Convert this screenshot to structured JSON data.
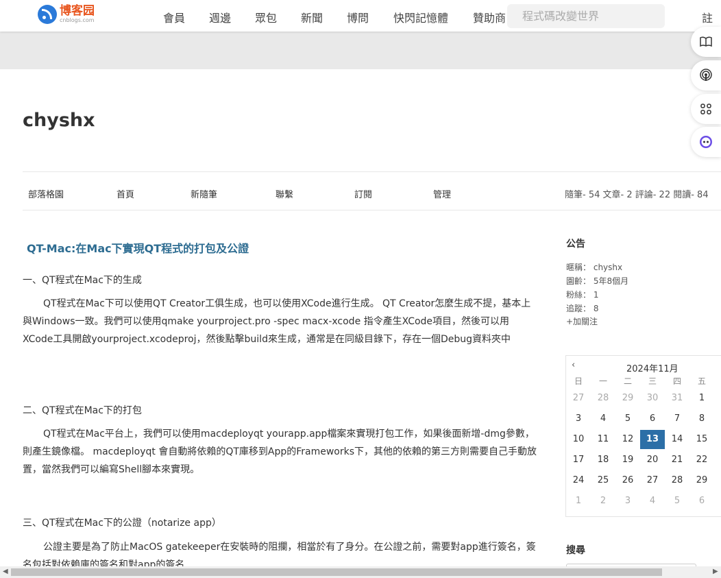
{
  "topbar": {
    "logo_name": "博客园",
    "logo_domain": "cnblogs.com",
    "nav": [
      "會員",
      "週邊",
      "眾包",
      "新聞",
      "博問",
      "快閃記憶體",
      "贊助商"
    ],
    "search_placeholder": "程式碼改變世界",
    "register": "註冊"
  },
  "side_tools": [
    "book-icon",
    "podcast-icon",
    "apps-icon",
    "assistant-icon"
  ],
  "blog": {
    "title": "chyshx",
    "nav": [
      "部落格園",
      "首頁",
      "新隨筆",
      "聯繫",
      "訂閱",
      "管理"
    ],
    "stats": "隨筆- 54  文章- 2  評論- 22  閱讀- 84"
  },
  "post": {
    "title": "QT-Mac:在Mac下實現QT程式的打包及公證",
    "sections": [
      {
        "heading": "一、QT程式在Mac下的生成",
        "text": "QT程式在Mac下可以使用QT Creator工俱生成，也可以使用XCode進行生成。 QT Creator怎麼生成不提，基本上與Windows一致。我們可以使用qmake yourproject.pro -spec macx-xcode 指令產生XCode項目，然後可以用XCode工具開啟yourproject.xcodeproj，然後點擊build來生成，通常是在同級目錄下，存在一個Debug資料夾中"
      },
      {
        "heading": "二、QT程式在Mac下的打包",
        "text": "QT程式在Mac平台上，我們可以使用macdeployqt yourapp.app檔案來實現打包工作，如果後面新增-dmg參數，則產生鏡像檔。 macdeployqt 會自動將依賴的QT庫移到App的Frameworks下，其他的依賴的第三方則需要自己手動放置，當然我們可以編寫Shell腳本來實現。"
      },
      {
        "heading": "三、QT程式在Mac下的公證（notarize app）",
        "text": "公證主要是為了防止MacOS gatekeeper在安裝時的阻攔，相當於有了身分。在公證之前，需要對app進行簽名，簽名包括對依賴庫的簽名和對app的簽名"
      }
    ]
  },
  "sidebar": {
    "notice_title": "公告",
    "profile": [
      {
        "label": "暱稱：",
        "value": "chyshx"
      },
      {
        "label": "園齡：",
        "value": "5年8個月"
      },
      {
        "label": "粉絲：",
        "value": "1"
      },
      {
        "label": "追蹤：",
        "value": "8"
      }
    ],
    "follow": "+加關注",
    "search_title": "搜尋"
  },
  "calendar": {
    "prev": "‹",
    "title": "2024年11月",
    "weekdays": [
      "日",
      "一",
      "二",
      "三",
      "四",
      "五"
    ],
    "weeks": [
      [
        "27",
        "28",
        "29",
        "30",
        "31",
        "1"
      ],
      [
        "3",
        "4",
        "5",
        "6",
        "7",
        "8"
      ],
      [
        "10",
        "11",
        "12",
        "13",
        "14",
        "15"
      ],
      [
        "17",
        "18",
        "19",
        "20",
        "21",
        "22"
      ],
      [
        "24",
        "25",
        "26",
        "27",
        "28",
        "29"
      ],
      [
        "1",
        "2",
        "3",
        "4",
        "5",
        "6"
      ]
    ],
    "today": "13"
  }
}
